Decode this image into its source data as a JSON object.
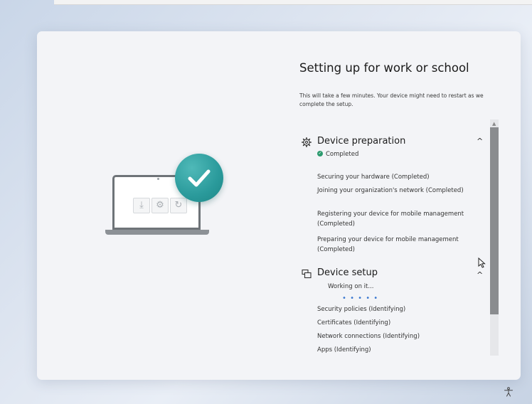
{
  "setup": {
    "title": "Setting up for work or school",
    "subtitle": "This will take a few minutes. Your device might need to restart as we complete the setup."
  },
  "device_preparation": {
    "title": "Device preparation",
    "status": "Completed",
    "expanded": true,
    "tasks": [
      "Securing your hardware (Completed)",
      "Joining your organization's network (Completed)",
      "Registering your device for mobile management (Completed)",
      "Preparing your device for mobile management (Completed)"
    ]
  },
  "device_setup": {
    "title": "Device setup",
    "status": "Working on it...",
    "progress_indicator": "• • • • •",
    "tasks": [
      "Security policies (Identifying)",
      "Certificates (Identifying)",
      "Network connections (Identifying)",
      "Apps (Identifying)"
    ]
  },
  "icons": {
    "device_preparation": "gear-icon",
    "device_setup": "device-setup-icon",
    "completed": "check-circle-icon",
    "illustration": "laptop-check-illustration",
    "accessibility": "accessibility-icon"
  },
  "colors": {
    "accent_teal": "#2a9a9b",
    "success_green": "#2b9a6e",
    "progress_blue": "#3b78d0",
    "card_background": "#f3f4f7"
  }
}
